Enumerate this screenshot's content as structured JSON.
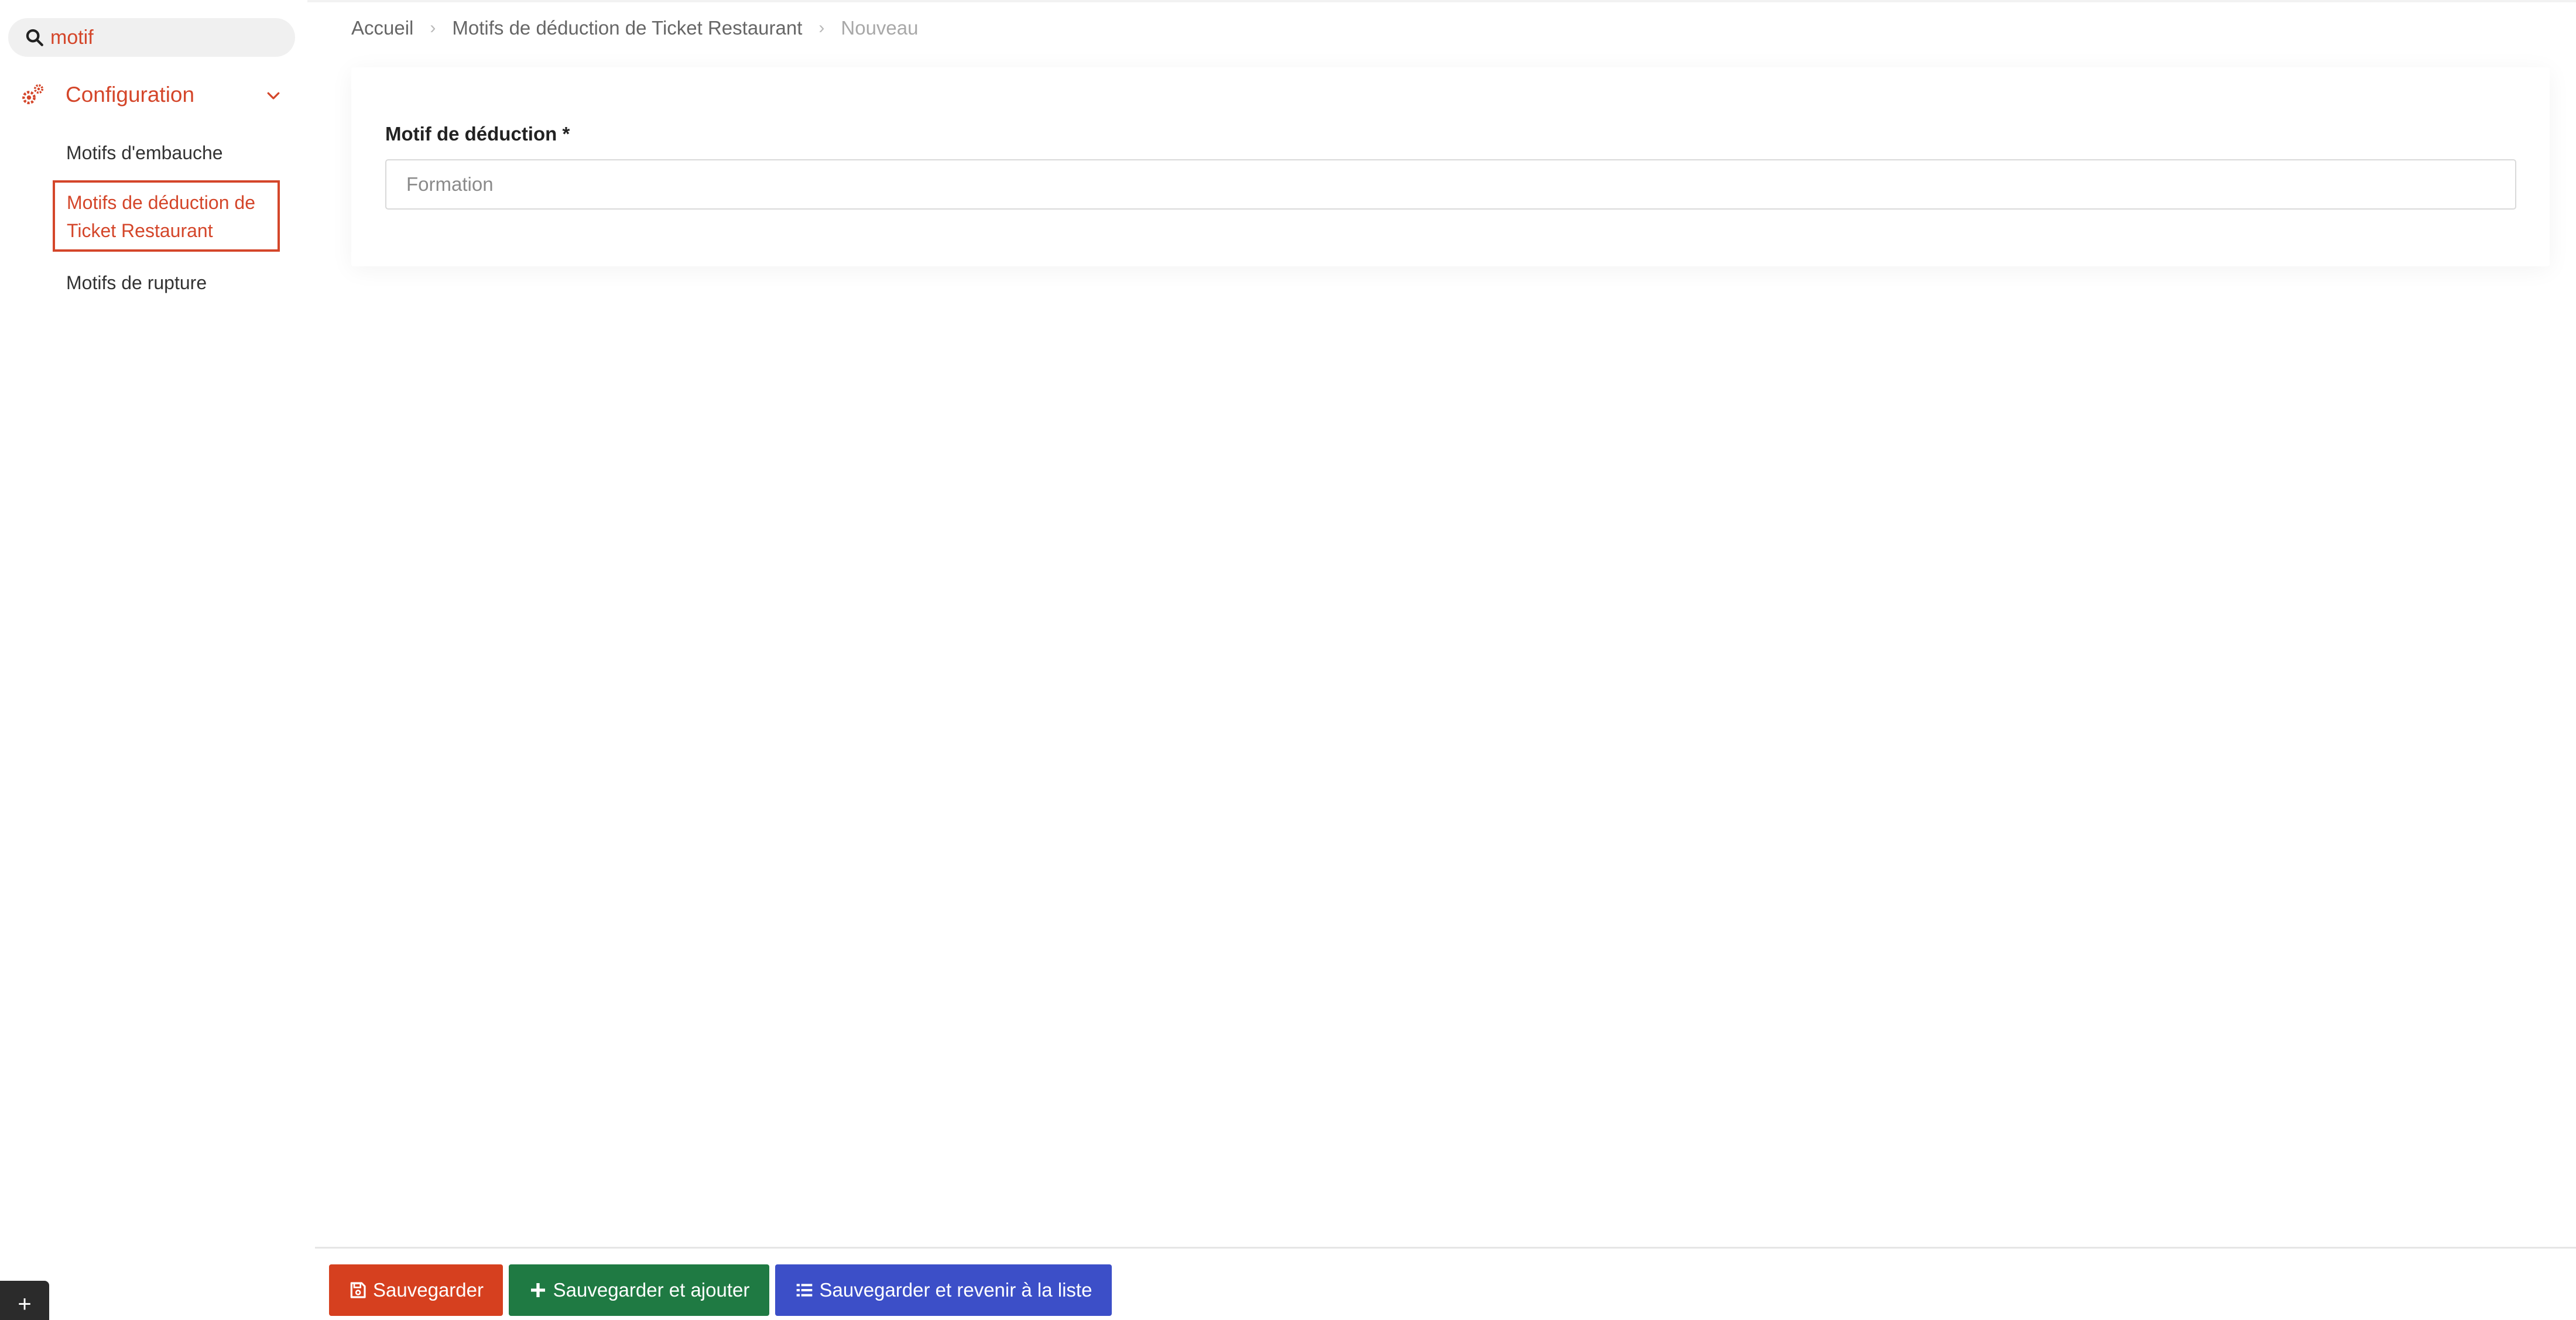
{
  "search": {
    "value": "motif"
  },
  "sidebar": {
    "section_label": "Configuration",
    "items": [
      {
        "label": "Motifs d'embauche"
      },
      {
        "label": "Motifs de déduction de Ticket Restaurant",
        "line1": "Motifs de déduction de",
        "line2": "Ticket Restaurant",
        "active": true
      },
      {
        "label": "Motifs de rupture"
      }
    ],
    "corner_button": "+"
  },
  "breadcrumb": {
    "items": [
      "Accueil",
      "Motifs de déduction de Ticket Restaurant",
      "Nouveau"
    ],
    "separator": "›"
  },
  "form": {
    "field_label": "Motif de déduction *",
    "field_placeholder": "Formation",
    "field_value": ""
  },
  "actions": {
    "save": "Sauvegarder",
    "save_add": "Sauvegarder et ajouter",
    "save_list": "Sauvegarder et revenir à la liste"
  },
  "colors": {
    "accent": "#d4462a",
    "save": "#d6401f",
    "save_add": "#1f7a43",
    "save_list": "#3c4fc8"
  },
  "icons": {
    "search": "search-icon",
    "config": "gears-icon",
    "chevron": "chevron-down-icon",
    "save": "floppy-disk-icon",
    "add": "plus-icon",
    "list": "list-icon"
  }
}
